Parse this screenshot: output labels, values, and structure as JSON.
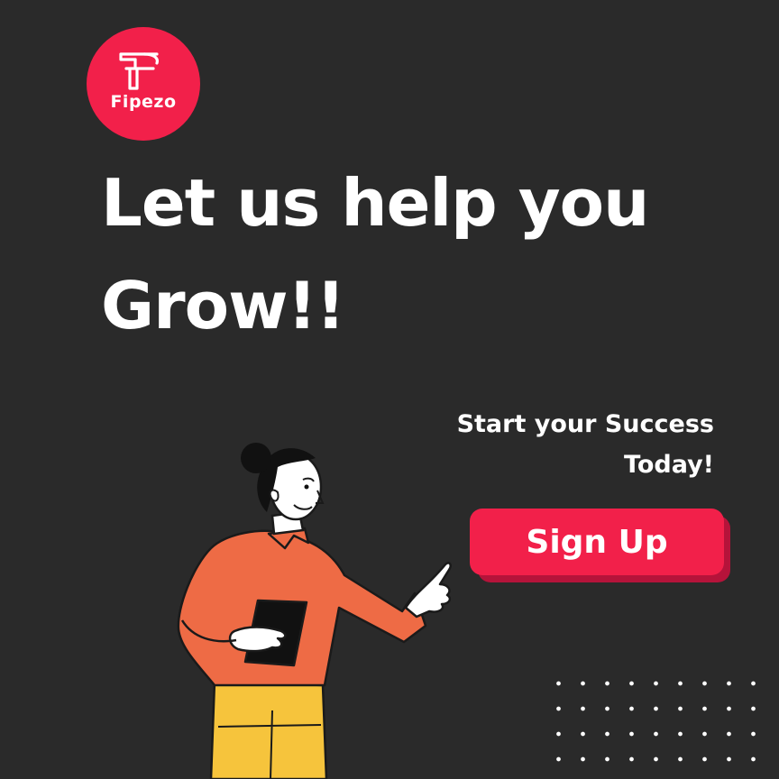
{
  "brand": {
    "name": "Fipezo",
    "accent_color": "#f2204a",
    "background_color": "#2a2a2a",
    "logo_icon": "fipezo-f-monogram-icon"
  },
  "hero": {
    "headline_line1": "Let us help you",
    "headline_line2": "Grow!!"
  },
  "cta": {
    "tagline_line1": "Start your Success",
    "tagline_line2": "Today!",
    "button_label": "Sign Up"
  },
  "illustration": {
    "name": "woman-pointing-illustration",
    "shirt_color": "#ee6b45",
    "pants_color": "#f6c43c"
  }
}
